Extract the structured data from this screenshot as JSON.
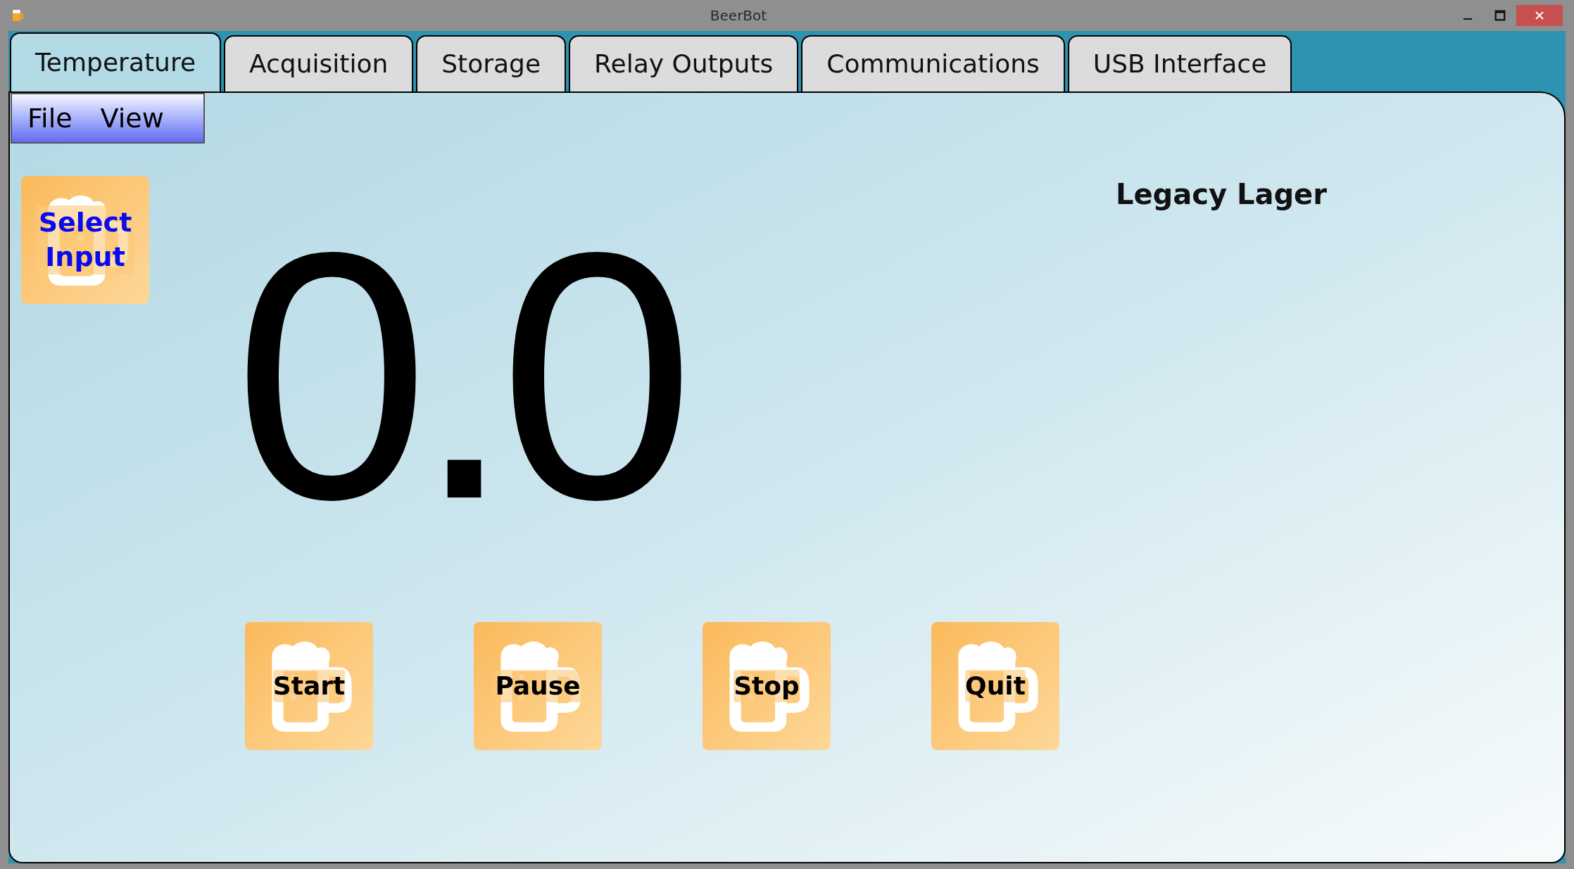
{
  "window": {
    "title": "BeerBot"
  },
  "tabs": [
    {
      "label": "Temperature",
      "selected": true
    },
    {
      "label": "Acquisition",
      "selected": false
    },
    {
      "label": "Storage",
      "selected": false
    },
    {
      "label": "Relay Outputs",
      "selected": false
    },
    {
      "label": "Communications",
      "selected": false
    },
    {
      "label": "USB Interface",
      "selected": false
    }
  ],
  "menu": [
    "File",
    "View"
  ],
  "select_input": {
    "label": "Select Input"
  },
  "profile_name": "Legacy Lager",
  "temperature": "0.0",
  "buttons": [
    "Start",
    "Pause",
    "Stop",
    "Quit"
  ]
}
